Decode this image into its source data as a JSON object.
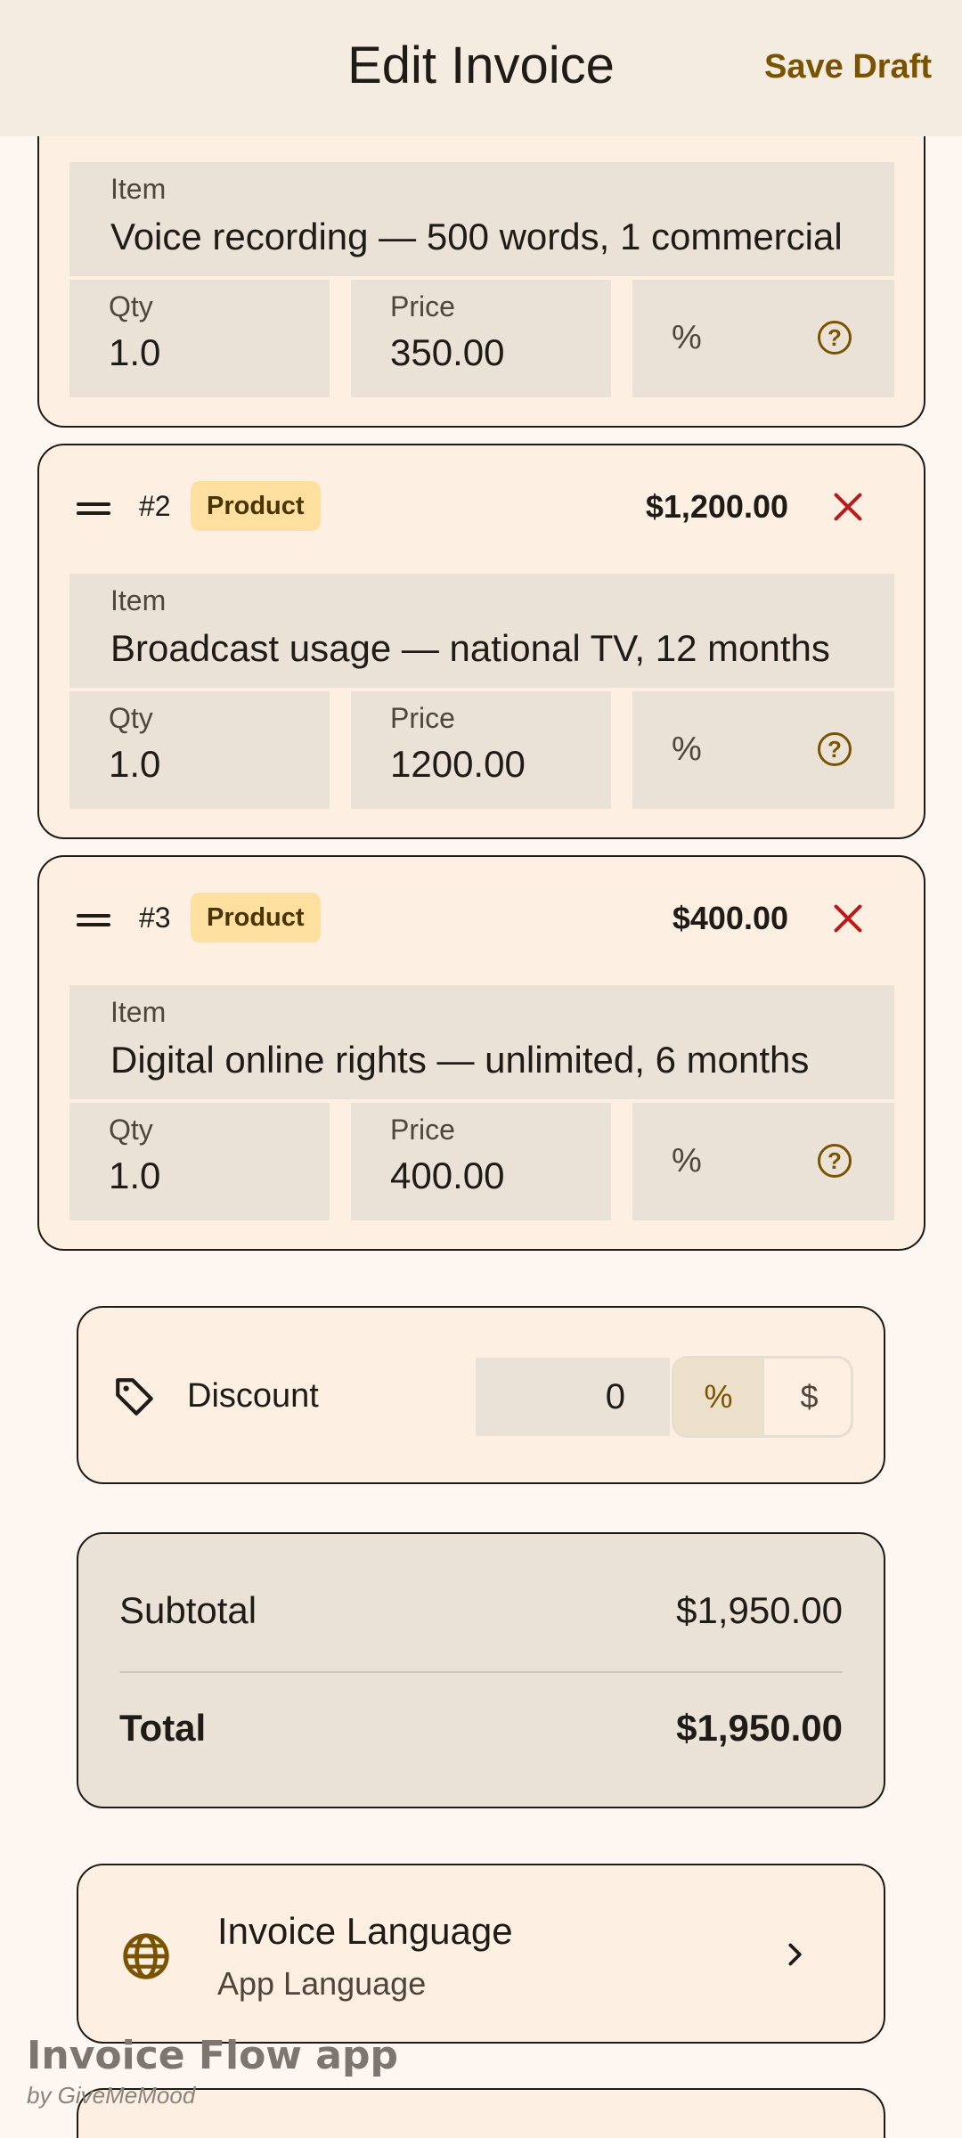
{
  "appbar": {
    "title": "Edit Invoice",
    "save_label": "Save Draft"
  },
  "labels": {
    "item": "Item",
    "qty": "Qty",
    "price": "Price",
    "percent": "%",
    "help": "?"
  },
  "items": [
    {
      "number": "",
      "badge": "",
      "amount": "",
      "item": "Voice recording — 500 words, 1 commercial",
      "qty": "1.0",
      "price": "350.00"
    },
    {
      "number": "#2",
      "badge": "Product",
      "amount": "$1,200.00",
      "item": "Broadcast usage — national TV, 12 months",
      "qty": "1.0",
      "price": "1200.00"
    },
    {
      "number": "#3",
      "badge": "Product",
      "amount": "$400.00",
      "item": "Digital online rights — unlimited, 6 months",
      "qty": "1.0",
      "price": "400.00"
    }
  ],
  "discount": {
    "label": "Discount",
    "value": "0",
    "pct": "%",
    "dollar": "$"
  },
  "totals": {
    "subtotal_label": "Subtotal",
    "subtotal": "$1,950.00",
    "total_label": "Total",
    "total": "$1,950.00"
  },
  "language": {
    "title": "Invoice Language",
    "subtitle": "App Language"
  },
  "watermark": {
    "title": "Invoice Flow app",
    "subtitle": "by GiveMeMood"
  },
  "colors": {
    "accent": "#7A5300",
    "danger": "#BA1A1A",
    "badge": "#FDDF9F"
  }
}
